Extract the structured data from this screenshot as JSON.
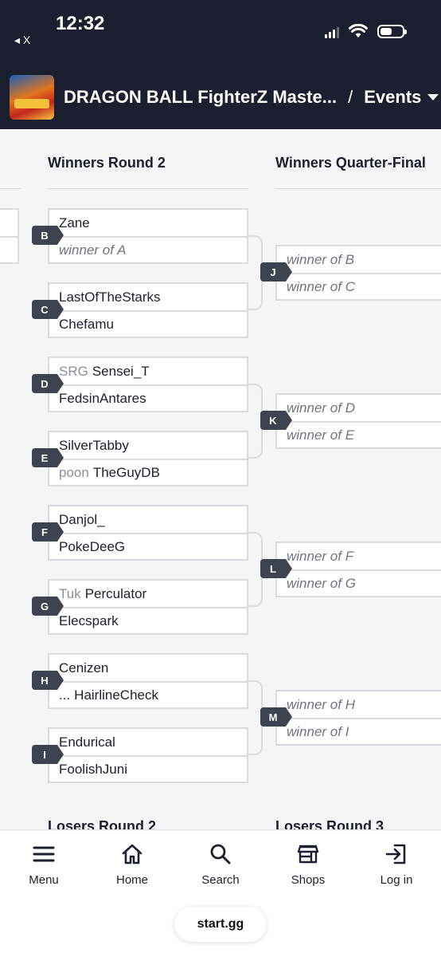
{
  "status": {
    "time": "12:32",
    "back_label": "◂ X"
  },
  "header": {
    "title": "DRAGON BALL FighterZ Maste...",
    "separator": "/",
    "events_label": "Events"
  },
  "bracket": {
    "rounds": [
      {
        "title": "Winners Round 2"
      },
      {
        "title": "Winners Quarter-Final"
      }
    ],
    "sets": [
      {
        "id": "B",
        "p1_prefix": "",
        "p1": "Zane",
        "p2_prefix": "",
        "p2": "winner of A",
        "p2_tbd": true
      },
      {
        "id": "C",
        "p1_prefix": "",
        "p1": "LastOfTheStarks",
        "p2_prefix": "",
        "p2": "Chefamu"
      },
      {
        "id": "D",
        "p1_prefix": "SRG",
        "p1": "Sensei_T",
        "p2_prefix": "",
        "p2": "FedsinAntares"
      },
      {
        "id": "E",
        "p1_prefix": "",
        "p1": "SilverTabby",
        "p2_prefix": "poon",
        "p2": "TheGuyDB"
      },
      {
        "id": "F",
        "p1_prefix": "",
        "p1": "Danjol_",
        "p2_prefix": "",
        "p2": "PokeDeeG"
      },
      {
        "id": "G",
        "p1_prefix": "Tuk",
        "p1": "Perculator",
        "p2_prefix": "",
        "p2": "Elecspark"
      },
      {
        "id": "H",
        "p1_prefix": "",
        "p1": "Cenizen",
        "p2_prefix": "...",
        "p2": "HairlineCheck"
      },
      {
        "id": "I",
        "p1_prefix": "",
        "p1": "Endurical",
        "p2_prefix": "",
        "p2": "FoolishJuni"
      }
    ],
    "quarter_sets": [
      {
        "id": "J",
        "p1": "winner of B",
        "p2": "winner of C"
      },
      {
        "id": "K",
        "p1": "winner of D",
        "p2": "winner of E"
      },
      {
        "id": "L",
        "p1": "winner of F",
        "p2": "winner of G"
      },
      {
        "id": "M",
        "p1": "winner of H",
        "p2": "winner of I"
      }
    ],
    "next_rounds": [
      {
        "title": "Losers Round 2"
      },
      {
        "title": "Losers Round 3"
      }
    ]
  },
  "tabbar": {
    "items": [
      {
        "label": "Menu",
        "icon": "menu-icon"
      },
      {
        "label": "Home",
        "icon": "home-icon"
      },
      {
        "label": "Search",
        "icon": "search-icon"
      },
      {
        "label": "Shops",
        "icon": "shop-icon"
      },
      {
        "label": "Log in",
        "icon": "login-icon"
      }
    ],
    "url": "start.gg"
  }
}
